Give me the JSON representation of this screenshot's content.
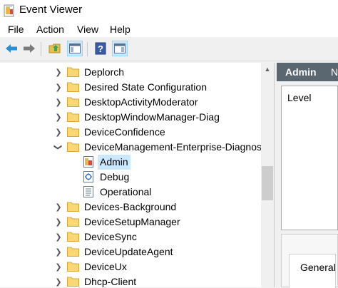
{
  "window": {
    "title": "Event Viewer",
    "app_icon": "event-viewer-icon"
  },
  "menu": [
    "File",
    "Action",
    "View",
    "Help"
  ],
  "toolbar": {
    "buttons": [
      {
        "name": "back-arrow-icon",
        "color": "#2b8fd8"
      },
      {
        "name": "forward-arrow-icon",
        "color": "#7a7a7a"
      },
      {
        "name": "up-folder-icon"
      },
      {
        "name": "show-hide-console-tree-icon",
        "pressed": true
      },
      {
        "name": "help-icon"
      },
      {
        "name": "show-hide-action-pane-icon",
        "pressed": true
      }
    ]
  },
  "tree": {
    "items": [
      {
        "label": "Deplorch",
        "type": "folder",
        "expanded": false
      },
      {
        "label": "Desired State Configuration",
        "type": "folder",
        "expanded": false
      },
      {
        "label": "DesktopActivityModerator",
        "type": "folder",
        "expanded": false
      },
      {
        "label": "DesktopWindowManager-Diag",
        "type": "folder",
        "expanded": false
      },
      {
        "label": "DeviceConfidence",
        "type": "folder",
        "expanded": false
      },
      {
        "label": "DeviceManagement-Enterprise-Diagnost",
        "type": "folder",
        "expanded": true
      },
      {
        "label": "Admin",
        "type": "log-admin",
        "selected": true
      },
      {
        "label": "Debug",
        "type": "log-debug"
      },
      {
        "label": "Operational",
        "type": "log-operational"
      },
      {
        "label": "Devices-Background",
        "type": "folder",
        "expanded": false
      },
      {
        "label": "DeviceSetupManager",
        "type": "folder",
        "expanded": false
      },
      {
        "label": "DeviceSync",
        "type": "folder",
        "expanded": false
      },
      {
        "label": "DeviceUpdateAgent",
        "type": "folder",
        "expanded": false
      },
      {
        "label": "DeviceUx",
        "type": "folder",
        "expanded": false
      },
      {
        "label": "Dhcp-Client",
        "type": "folder",
        "expanded": false
      }
    ],
    "selection_color": "#cce8ff"
  },
  "right_pane": {
    "header_title": "Admin",
    "header_extra": "N",
    "header_color": "#5a6670",
    "column_label": "Level",
    "tab_label": "General"
  }
}
